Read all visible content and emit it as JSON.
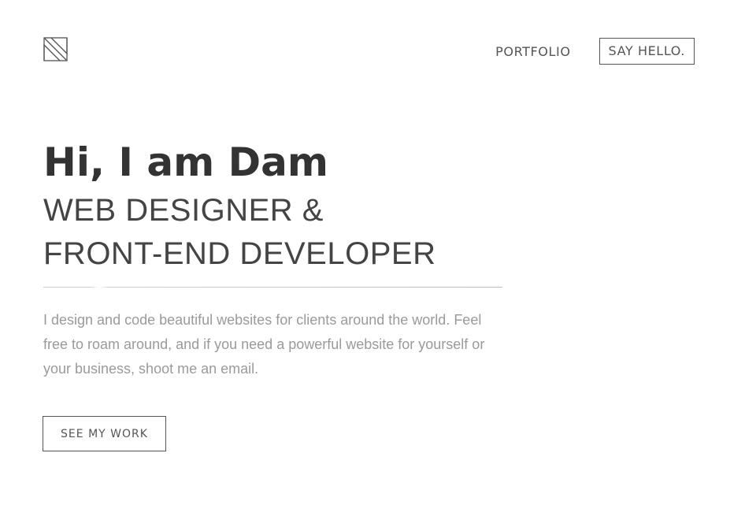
{
  "header": {
    "logo_icon": "monogram-logo-icon",
    "nav": {
      "portfolio_label": "PORTFOLIO",
      "contact_label": "SAY HELLO."
    }
  },
  "hero": {
    "title": "Hi, I am Dam",
    "subtitle_line1": "WEB DESIGNER &",
    "subtitle_line2": "FRONT-END DEVELOPER",
    "intro": "I design and code beautiful websites for clients around the world. Feel free to roam around, and if you need a powerful website for yourself or your business, shoot me an email.",
    "cta_label": "SEE MY WORK"
  },
  "colors": {
    "text_primary": "#333333",
    "text_secondary": "#9a9a9a",
    "border": "#555555",
    "background": "#ffffff"
  }
}
